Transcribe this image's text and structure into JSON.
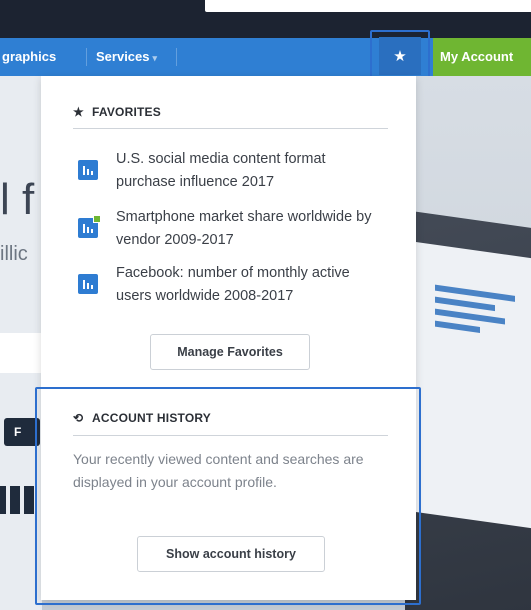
{
  "nav": {
    "infographics_label": "graphics",
    "services_label": "Services",
    "services_caret": "▾",
    "favorites_star": "★",
    "my_account_label": "My Account"
  },
  "background": {
    "heading_fragment": "l f",
    "subheading_fragment": "illic",
    "button_fragment": "F"
  },
  "favorites": {
    "title": "FAVORITES",
    "title_icon": "star-icon",
    "items": [
      {
        "label": "U.S. social media content format purchase influence 2017",
        "icon": "bar-chart-icon"
      },
      {
        "label": "Smartphone market share worldwide by vendor 2009-2017",
        "icon": "bar-chart-plus-icon"
      },
      {
        "label": "Facebook: number of monthly active users worldwide 2008-2017",
        "icon": "bar-chart-icon"
      }
    ],
    "manage_label": "Manage Favorites"
  },
  "history": {
    "title": "ACCOUNT HISTORY",
    "title_icon": "history-icon",
    "description": "Your recently viewed content and searches are displayed in your account profile.",
    "button_label": "Show account history"
  },
  "colors": {
    "nav_blue": "#2f7fd3",
    "account_green": "#6fb632",
    "highlight_border": "#2d6fce",
    "icon_blue": "#2e7cd2"
  }
}
